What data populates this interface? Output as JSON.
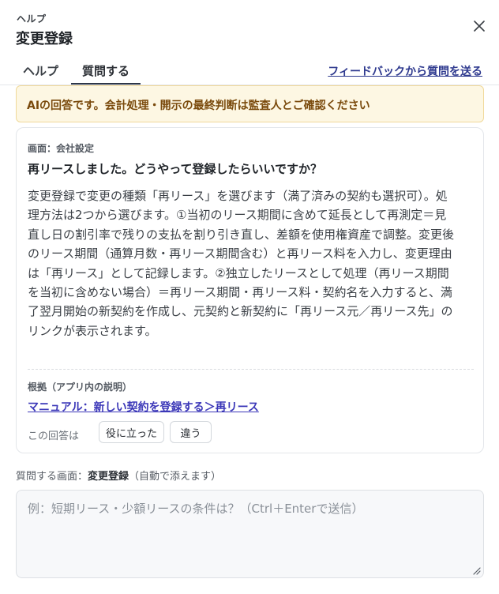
{
  "header": {
    "eyebrow": "ヘルプ",
    "title": "変更登録"
  },
  "tabs": [
    {
      "label": "ヘルプ",
      "active": false
    },
    {
      "label": "質問する",
      "active": true
    }
  ],
  "feedback_link": "フィードバックから質問を送る",
  "warning": "AIの回答です。会計処理・開示の最終判断は監査人とご確認ください",
  "answer": {
    "screen_label": "画面：会社設定",
    "question": "再リースしました。どうやって登録したらいいですか？",
    "body_lines": [
      "変更登録で変更の種類「再リース」を選びます（満了済みの契約も選択可）。処",
      "理方法は2つから選びます。①当初のリース期間に含めて延長として再測定＝見",
      "直し日の割引率で残りの支払を割り引き直し、差額を使用権資産で調整。変更後",
      "のリース期間（通算月数・再リース期間含む）と再リース料を入力し、変更理由",
      "は「再リース」として記録します。②独立したリースとして処理（再リース期間",
      "を当初に含めない場合）＝再リース期間・再リース料・契約名を入力すると、満",
      "了翌月開始の新契約を作成し、元契約と新契約に「再リース元／再リース先」の",
      "リンクが表示されます。"
    ],
    "source_label": "根拠（アプリ内の説明）",
    "source_link": "マニュアル：新しい契約を登録する＞再リース",
    "rate_label": "この回答は",
    "helpful_button": "役に立った",
    "wrong_button": "違う"
  },
  "context": {
    "prefix": "質問する画面：",
    "screen": "変更登録",
    "suffix": "（自動で添えます）"
  },
  "input": {
    "placeholder": "例：短期リース・少額リースの条件は？（Ctrl＋Enterで送信）",
    "value": ""
  },
  "colors": {
    "link": "#2f3a8f",
    "warning_bg": "#fdf7e3",
    "warning_text": "#7a4a0c",
    "manual_link": "#3b37b8"
  }
}
